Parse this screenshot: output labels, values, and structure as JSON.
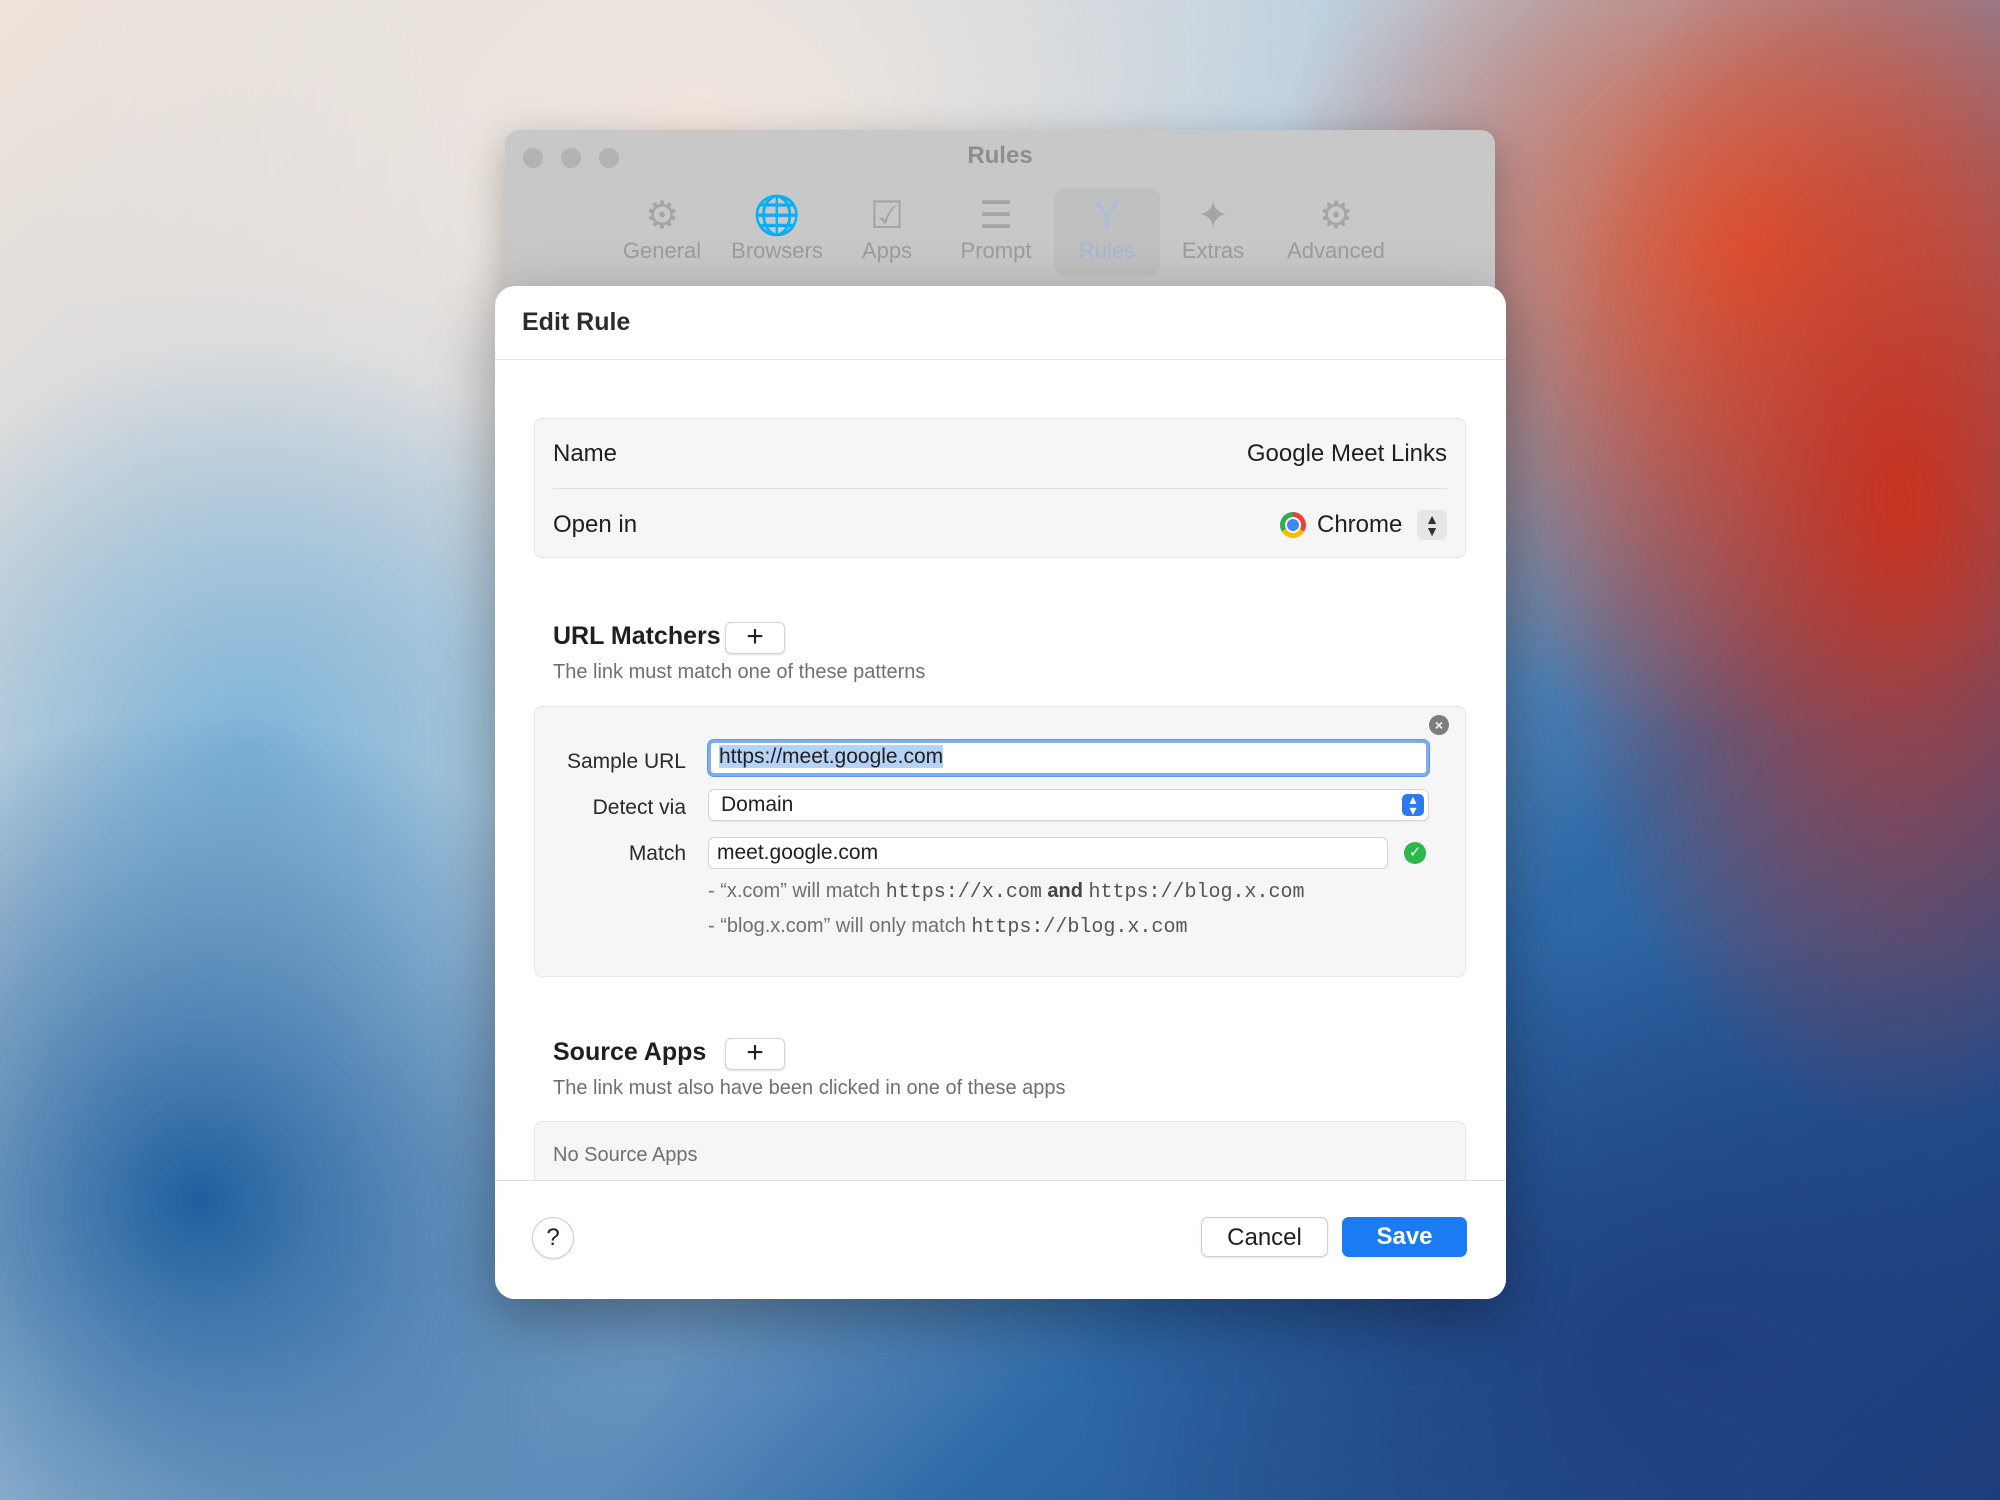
{
  "settings_window": {
    "title": "Rules",
    "tabs": [
      {
        "label": "General",
        "icon": "gear-icon",
        "glyph": "⚙"
      },
      {
        "label": "Browsers",
        "icon": "globe-icon",
        "glyph": "🌐"
      },
      {
        "label": "Apps",
        "icon": "app-check-icon",
        "glyph": "☑"
      },
      {
        "label": "Prompt",
        "icon": "list-icon",
        "glyph": "☰"
      },
      {
        "label": "Rules",
        "icon": "fork-icon",
        "glyph": "Y"
      },
      {
        "label": "Extras",
        "icon": "sparkles-icon",
        "glyph": "✦"
      },
      {
        "label": "Advanced",
        "icon": "gears-icon",
        "glyph": "⚙"
      }
    ],
    "active_tab": "Rules"
  },
  "sheet": {
    "title": "Edit Rule",
    "name_label": "Name",
    "name_value": "Google Meet Links",
    "open_in_label": "Open in",
    "open_in_value": "Chrome",
    "url_matchers": {
      "title": "URL Matchers",
      "add_label": "+",
      "subtitle": "The link must match one of these patterns",
      "sample_url_label": "Sample URL",
      "sample_url_value": "https://meet.google.com",
      "detect_via_label": "Detect via",
      "detect_via_value": "Domain",
      "match_label": "Match",
      "match_value": "meet.google.com",
      "hint1_pre": "- “x.com” will match",
      "hint1_url1": "https://x.com",
      "hint1_and": "and",
      "hint1_url2": "https://blog.x.com",
      "hint2_pre": "- “blog.x.com” will only match",
      "hint2_url": "https://blog.x.com"
    },
    "source_apps": {
      "title": "Source Apps",
      "add_label": "+",
      "subtitle": "The link must also have been clicked in one of these apps",
      "empty_text": "No Source Apps"
    },
    "footer": {
      "help_label": "?",
      "cancel_label": "Cancel",
      "save_label": "Save"
    }
  },
  "colors": {
    "accent": "#1a7bf2",
    "success": "#2fb84a"
  }
}
